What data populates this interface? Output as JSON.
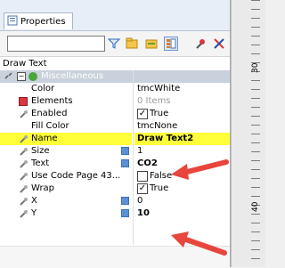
{
  "tab": {
    "label": "Properties"
  },
  "selection_title": "Draw Text",
  "group": {
    "label": "Miscellaneous"
  },
  "properties": [
    {
      "name": "Color",
      "value": "tmcWhite"
    },
    {
      "name": "Elements",
      "value": "0 Items"
    },
    {
      "name": "Enabled",
      "value": "True"
    },
    {
      "name": "Fill Color",
      "value": "tmcNone"
    },
    {
      "name": "Name",
      "value": "Draw Text2"
    },
    {
      "name": "Size",
      "value": "1"
    },
    {
      "name": "Text",
      "value": "CO2"
    },
    {
      "name": "Use Code Page 43...",
      "value": "False"
    },
    {
      "name": "Wrap",
      "value": "True"
    },
    {
      "name": "X",
      "value": "0"
    },
    {
      "name": "Y",
      "value": "10"
    }
  ],
  "ruler": {
    "label_top": "30",
    "label_bottom": "40"
  },
  "colors": {
    "highlight": "#ffff3a",
    "arrow": "#e8453c",
    "group_band": "#c9d1dc"
  }
}
